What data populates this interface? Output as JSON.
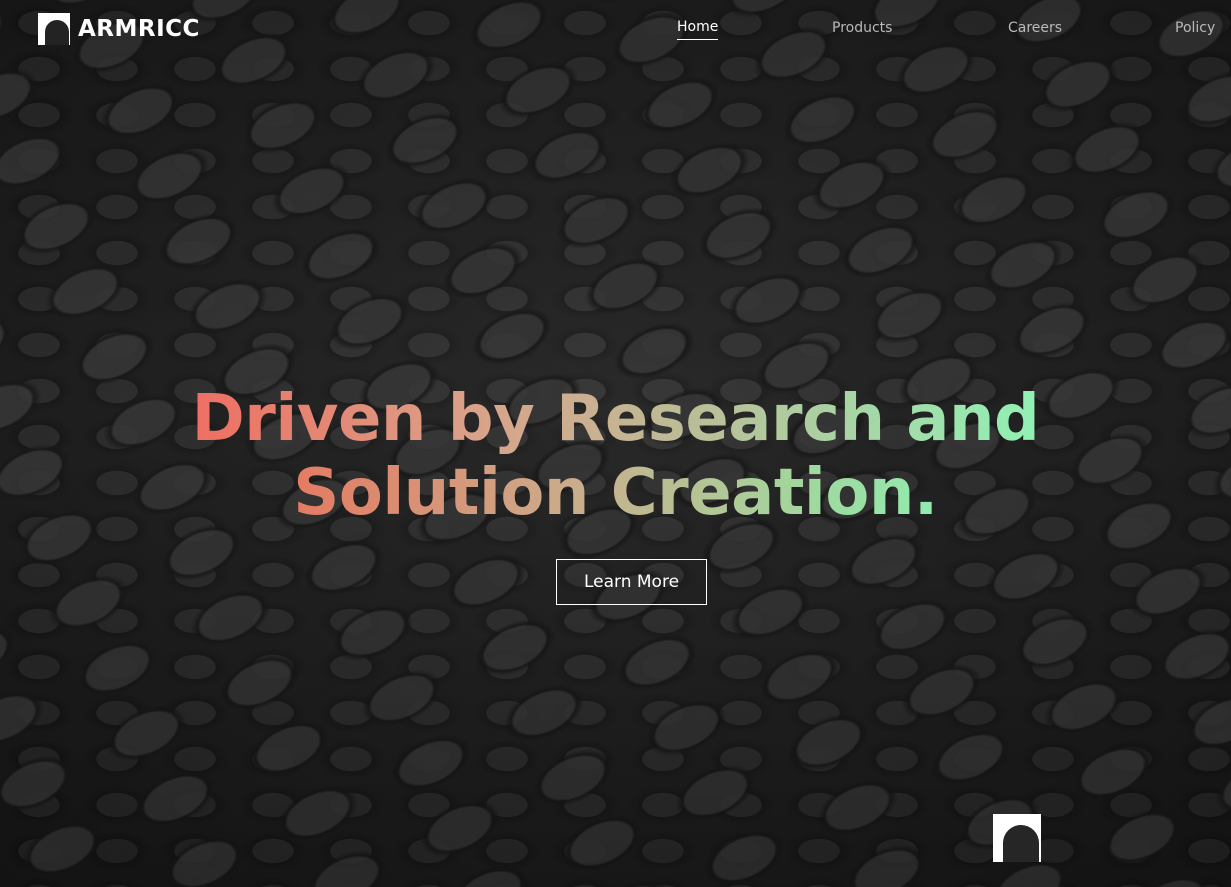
{
  "brand": {
    "name": "ARMRICC",
    "logo_icon": "armricc-logo-icon"
  },
  "nav": {
    "items": [
      {
        "label": "Home",
        "active": true
      },
      {
        "label": "Products",
        "active": false
      },
      {
        "label": "Careers",
        "active": false
      },
      {
        "label": "Policy",
        "active": false
      }
    ]
  },
  "hero": {
    "headline_line1": "Driven by Research and",
    "headline_line2": "Solution Creation.",
    "cta_label": "Learn More",
    "gradient_colors": [
      "#f06a5f",
      "#c9ae8c",
      "#8ef5b8"
    ],
    "background_theme": "dark textured cylinders"
  },
  "floating_badge": {
    "icon": "armricc-logo-icon"
  }
}
